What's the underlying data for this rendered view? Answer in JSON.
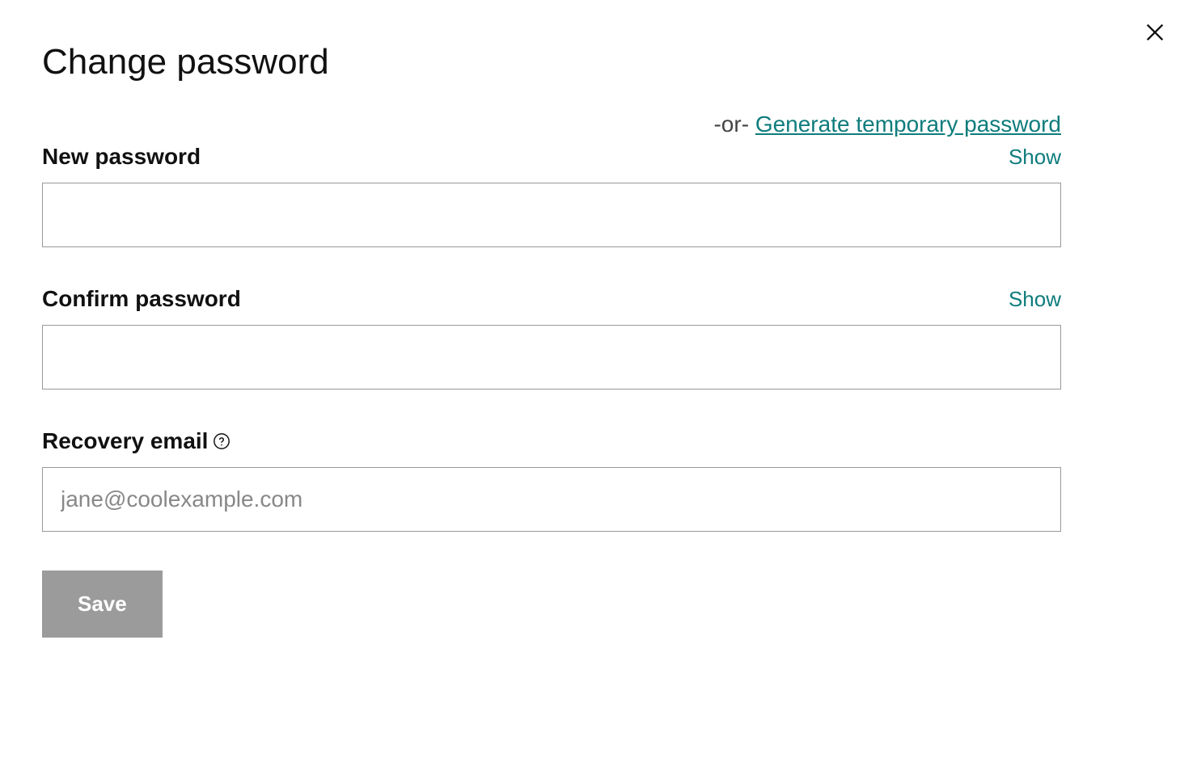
{
  "title": "Change password",
  "or": "-or- ",
  "generate_link": "Generate temporary password",
  "fields": {
    "new_password": {
      "label": "New password",
      "show": "Show",
      "value": ""
    },
    "confirm_password": {
      "label": "Confirm password",
      "show": "Show",
      "value": ""
    },
    "recovery_email": {
      "label": "Recovery email",
      "placeholder": "jane@coolexample.com",
      "value": ""
    }
  },
  "buttons": {
    "save": "Save"
  }
}
